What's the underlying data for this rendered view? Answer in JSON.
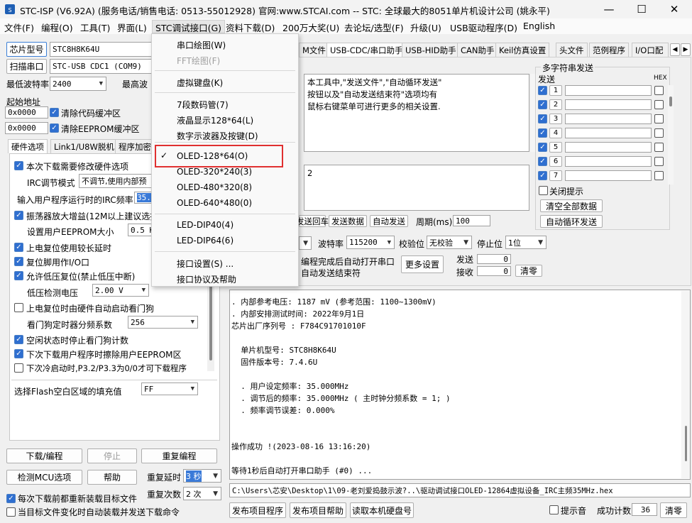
{
  "window": {
    "title": "STC-ISP (V6.92A) (服务电话/销售电话: 0513-55012928) 官网:www.STCAI.com  -- STC: 全球最大的8051单片机设计公司 (姚永平)",
    "minimize": "—",
    "maximize": "☐",
    "close": "✕"
  },
  "menubar": [
    {
      "label": "文件(F)"
    },
    {
      "label": "编程(O)"
    },
    {
      "label": "工具(T)"
    },
    {
      "label": "界面(L)"
    },
    {
      "label": "STC调试接口(G)"
    },
    {
      "label": "资料下载(D)"
    },
    {
      "label": "200万大奖(U)"
    },
    {
      "label": "去论坛/选型(F)"
    },
    {
      "label": "升级(U)"
    },
    {
      "label": "USB驱动程序(D)"
    },
    {
      "label": "English"
    }
  ],
  "dropdown": {
    "items": [
      {
        "label": "串口绘图(W)"
      },
      {
        "label": "FFT绘图(F)"
      },
      {
        "label": "虚拟键盘(K)"
      },
      {
        "label": "7段数码管(7)"
      },
      {
        "label": "液晶显示128*64(L)"
      },
      {
        "label": "数字示波器及按键(D)"
      },
      {
        "label": "OLED-128*64(O)",
        "check": "✓"
      },
      {
        "label": "OLED-320*240(3)"
      },
      {
        "label": "OLED-480*320(8)"
      },
      {
        "label": "OLED-640*480(0)"
      },
      {
        "label": "LED-DIP40(4)"
      },
      {
        "label": "LED-DIP64(6)"
      },
      {
        "label": "接口设置(S) ..."
      },
      {
        "label": "接口协议及帮助"
      }
    ],
    "highlight_color": "#e03030"
  },
  "left": {
    "chip_type_label": "芯片型号",
    "chip_value": "STC8H8K64U",
    "scan_port_label": "扫描串口",
    "port_value": "STC-USB CDC1 (COM9)",
    "min_baud_label": "最低波特率",
    "min_baud_value": "2400",
    "max_baud_label": "最高波",
    "start_addr_label": "起始地址",
    "addr1": "0x0000",
    "addr2": "0x0000",
    "clear_code": "清除代码缓冲区",
    "clear_eeprom": "清除EEPROM缓冲区",
    "tabs": [
      "硬件选项",
      "Link1/U8W脱机",
      "程序加密"
    ],
    "options": {
      "modify_hw": "本次下载需要修改硬件选项",
      "irc_mode_label": "IRC调节模式",
      "irc_mode_value": "不调节,使用内部预",
      "irc_freq_label": "输入用户程序运行时的IRC频率",
      "irc_freq_value": "35.0",
      "osc_gain": "振荡器放大增益(12M以上建议选择",
      "eeprom_size_label": "设置用户EEPROM大小",
      "eeprom_size_value": "0.5 K",
      "long_reset": "上电复位使用较长延时",
      "reset_io": "复位脚用作I/O口",
      "low_volt_reset": "允许低压复位(禁止低压中断)",
      "low_volt_label": "低压检测电压",
      "low_volt_value": "2.00 V",
      "hw_wdt": "上电复位时由硬件自动启动看门狗",
      "wdt_div_label": "看门狗定时器分频系数",
      "wdt_div_value": "256",
      "idle_wdt": "空闲状态时停止看门狗计数",
      "erase_eeprom": "下次下载用户程序时擦除用户EEPROM区",
      "cold_boot": "下次冷启动时,P3.2/P3.3为0/0才可下载程序",
      "flash_fill_label": "选择Flash空白区域的填充值",
      "flash_fill_value": "FF"
    },
    "buttons": {
      "download": "下载/编程",
      "stop": "停止",
      "reprogram": "重复编程",
      "check_mcu": "检测MCU选项",
      "help": "帮助",
      "repeat_delay_label": "重复延时",
      "repeat_delay_value": "3 秒",
      "repeat_count_label": "重复次数",
      "repeat_count_value": "2 次"
    },
    "reload_each": "每次下载前都重新装载目标文件",
    "auto_reload": "当目标文件变化时自动装载并发送下载命令"
  },
  "right": {
    "tabs": [
      "M文件",
      "USB-CDC/串口助手",
      "USB-HID助手",
      "CAN助手",
      "Keil仿真设置",
      "头文件",
      "范例程序",
      "I/O口配"
    ],
    "info_text": "本工具中,\"发送文件\",\"自动循环发送\"\n按钮以及\"自动发送结束符\"选项均有\n鼠标右键菜单可进行更多的相关设置.",
    "recv_value": "2",
    "send_return": "发送回车",
    "send_data": "发送数据",
    "auto_send": "自动发送",
    "period_label": "周期(ms)",
    "period_value": "100",
    "baud_label": "波特率",
    "baud_value": "115200",
    "parity_label": "校验位",
    "parity_value": "无校验",
    "stop_label": "停止位",
    "stop_value": "1位",
    "after_prog": "编程完成后自动打开串口",
    "auto_end": "自动发送结束符",
    "more_settings": "更多设置",
    "send_label": "发送",
    "send_count": "0",
    "recv_label": "接收",
    "recv_count": "0",
    "clear": "清零",
    "multi": {
      "title": "多字符串发送",
      "send_col": "发送",
      "hex_col": "HEX",
      "rows": [
        "1",
        "2",
        "3",
        "4",
        "5",
        "6",
        "7"
      ],
      "close_tip": "关闭提示",
      "clear_all": "清空全部数据",
      "auto_loop": "自动循环发送"
    }
  },
  "log": {
    "lines": [
      ". 内部参考电压: 1187 mV (参考范围: 1100~1300mV)",
      ". 内部安排测试时间: 2022年9月1日",
      "芯片出厂序列号 : F784C91701010F",
      "",
      "  单片机型号: STC8H8K64U",
      "  固件版本号: 7.4.6U",
      "",
      "  . 用户设定频率: 35.000MHz",
      "  . 调节后的频率: 35.000MHz ( 主时钟分频系数 = 1; )",
      "  . 频率调节误差: 0.000%",
      "",
      "",
      "操作成功 !(2023-08-16 13:16:20)",
      "",
      "等待1秒后自动打开串口助手 (#0) ..."
    ]
  },
  "path": "C:\\Users\\芯安\\Desktop\\1\\09-老刘爱捣鼓示波?..\\驱动调试接口OLED-12864虚拟设备_IRC主频35MHz.hex",
  "bottom": {
    "publish_project": "发布项目程序",
    "publish_help": "发布项目帮助",
    "read_disk": "读取本机硬盘号",
    "beep": "提示音",
    "success_label": "成功计数",
    "success_value": "36",
    "clear": "清零"
  }
}
